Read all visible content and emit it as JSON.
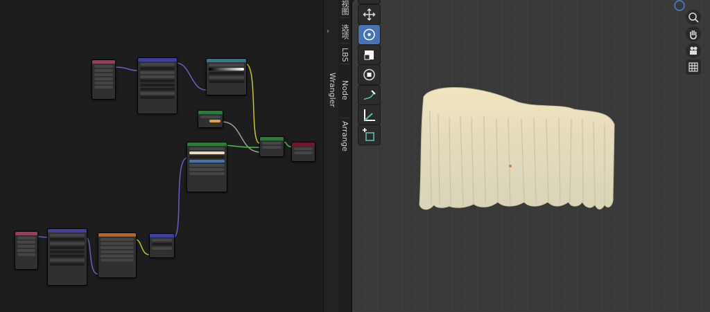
{
  "sidebar_tabs": [
    {
      "label": "视图"
    },
    {
      "label": "选项"
    },
    {
      "label": "LBS"
    },
    {
      "label": "Node Wrangler"
    },
    {
      "label": "Arrange"
    }
  ],
  "toolbar": {
    "tools": [
      {
        "name": "move",
        "icon": "move-icon",
        "active": false
      },
      {
        "name": "rotate",
        "icon": "rotate-icon",
        "active": true
      },
      {
        "name": "scale",
        "icon": "scale-icon",
        "active": false
      },
      {
        "name": "transform",
        "icon": "transform-icon",
        "active": false
      },
      {
        "name": "annotate",
        "icon": "annotate-icon",
        "active": false
      },
      {
        "name": "measure",
        "icon": "measure-icon",
        "active": false
      },
      {
        "name": "add-cube",
        "icon": "add-cube-icon",
        "active": false
      }
    ]
  },
  "nav_gizmo": [
    "zoom-icon",
    "hand-pan-icon",
    "camera-icon",
    "grid-icon"
  ],
  "colors": {
    "node_header_red": "#a33a55",
    "node_header_blue": "#3f3f9e",
    "node_header_teal": "#2d7a8c",
    "node_header_green": "#2f7a3a",
    "node_header_orange": "#b5651d",
    "node_header_darkred": "#6a1a2a",
    "link_purple": "#6363c7",
    "link_yellow": "#c7c729",
    "link_gray": "#a1a1a1",
    "link_green": "#4fbf4f",
    "active_tool": "#4772b3",
    "mesh_cream": "#e8dfb8"
  }
}
